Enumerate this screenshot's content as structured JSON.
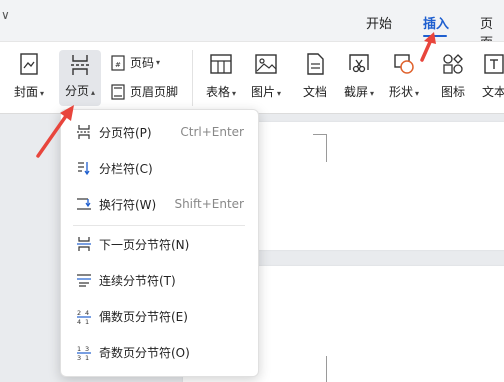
{
  "menu_tabs": [
    {
      "label": "开始",
      "active": false
    },
    {
      "label": "插入",
      "active": true
    },
    {
      "label": "页面",
      "active": false
    }
  ],
  "ribbon": {
    "cover": "封面",
    "page_break": "分页",
    "page_number": "页码",
    "header_footer": "页眉页脚",
    "table": "表格",
    "picture": "图片",
    "document": "文档",
    "screenshot": "截屏",
    "shape": "形状",
    "icon": "图标",
    "textbox": "文本"
  },
  "page_break_menu": {
    "items": [
      {
        "label": "分页符(P)",
        "shortcut": "Ctrl+Enter",
        "icon": "page-break-icon"
      },
      {
        "label": "分栏符(C)",
        "shortcut": "",
        "icon": "column-break-icon"
      },
      {
        "label": "换行符(W)",
        "shortcut": "Shift+Enter",
        "icon": "line-break-icon"
      },
      {
        "label": "下一页分节符(N)",
        "shortcut": "",
        "icon": "next-page-section-icon"
      },
      {
        "label": "连续分节符(T)",
        "shortcut": "",
        "icon": "continuous-section-icon"
      },
      {
        "label": "偶数页分节符(E)",
        "shortcut": "",
        "icon": "even-page-section-icon"
      },
      {
        "label": "奇数页分节符(O)",
        "shortcut": "",
        "icon": "odd-page-section-icon"
      }
    ]
  },
  "colors": {
    "accent": "#1f5fcf",
    "annotation_arrow": "#e8453c"
  }
}
